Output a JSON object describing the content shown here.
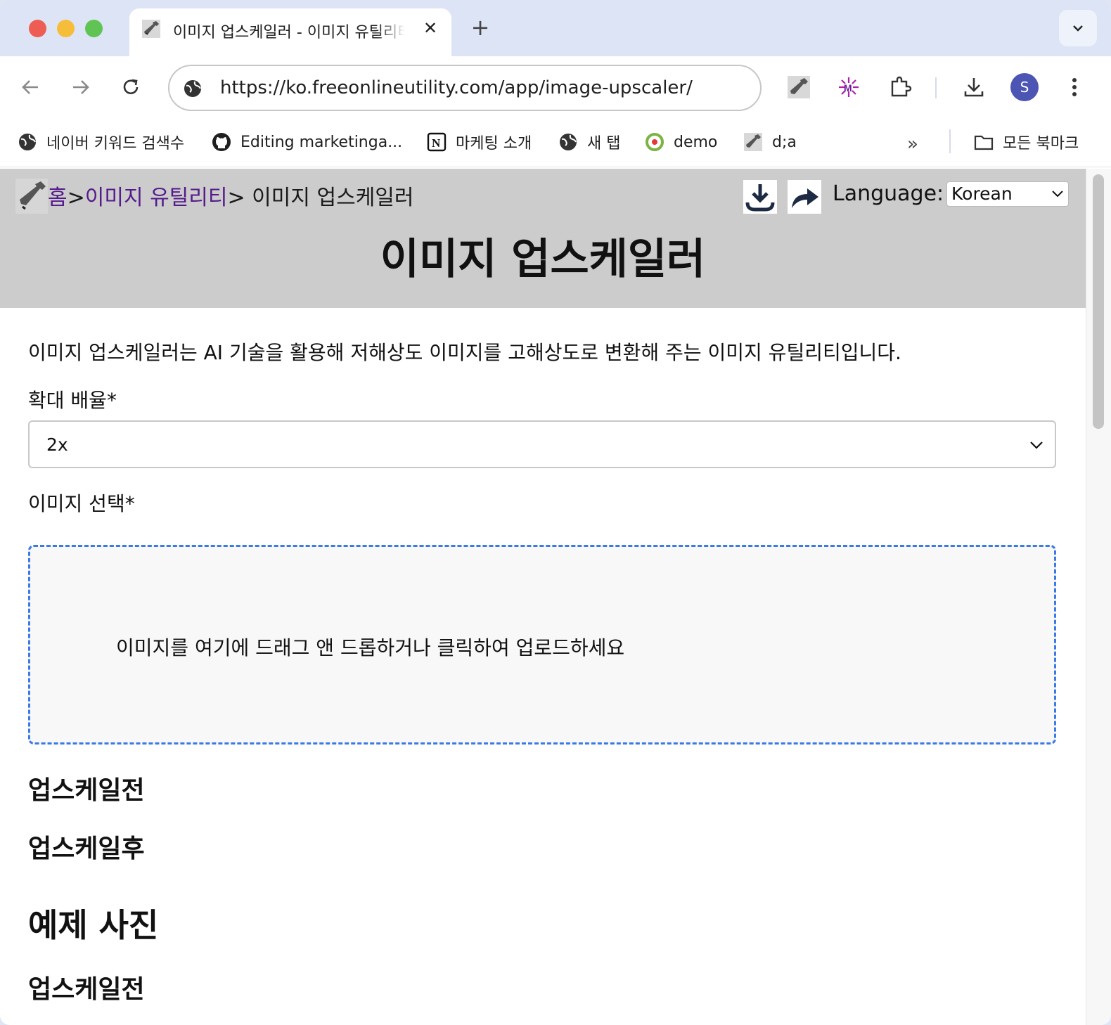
{
  "browser": {
    "tab": {
      "title": "이미지 업스케일러 - 이미지 유틸리티",
      "close_glyph": "✕"
    },
    "new_tab_glyph": "+",
    "address_bar": {
      "url": "https://ko.freeonlineutility.com/app/image-upscaler/"
    },
    "profile_initial": "S",
    "bookmarks": [
      {
        "label": "네이버 키워드 검색수",
        "icon": "globe-icon"
      },
      {
        "label": "Editing marketinga...",
        "icon": "github-icon"
      },
      {
        "label": "마케팅 소개",
        "icon": "notion-icon"
      },
      {
        "label": "새 탭",
        "icon": "globe-icon"
      },
      {
        "label": "demo",
        "icon": "demo-icon"
      },
      {
        "label": "d;a",
        "icon": "wrench-icon"
      }
    ],
    "bookmarks_overflow": "»",
    "all_bookmarks": "모든 북마크"
  },
  "page": {
    "breadcrumb": {
      "home": "홈",
      "sep1": ">",
      "category": "이미지 유틸리티",
      "current": "> 이미지 업스케일러"
    },
    "language_label": "Language:",
    "language_value": "Korean",
    "title": "이미지 업스케일러",
    "description": "이미지 업스케일러는 AI 기술을 활용해 저해상도 이미지를 고해상도로 변환해 주는 이미지 유틸리티입니다.",
    "scale_label": "확대 배율*",
    "scale_value": "2x",
    "image_label": "이미지 선택*",
    "dropzone_text": "이미지를 여기에 드래그 앤 드롭하거나 클릭하여 업로드하세요",
    "before_heading": "업스케일전",
    "after_heading": "업스케일후",
    "examples_heading": "예제 사진",
    "example_before_heading": "업스케일전"
  },
  "colors": {
    "header_band": "#cccccc",
    "link_visited": "#551a8b",
    "dropzone_border": "#3b7ae6",
    "avatar": "#4c55b4"
  }
}
